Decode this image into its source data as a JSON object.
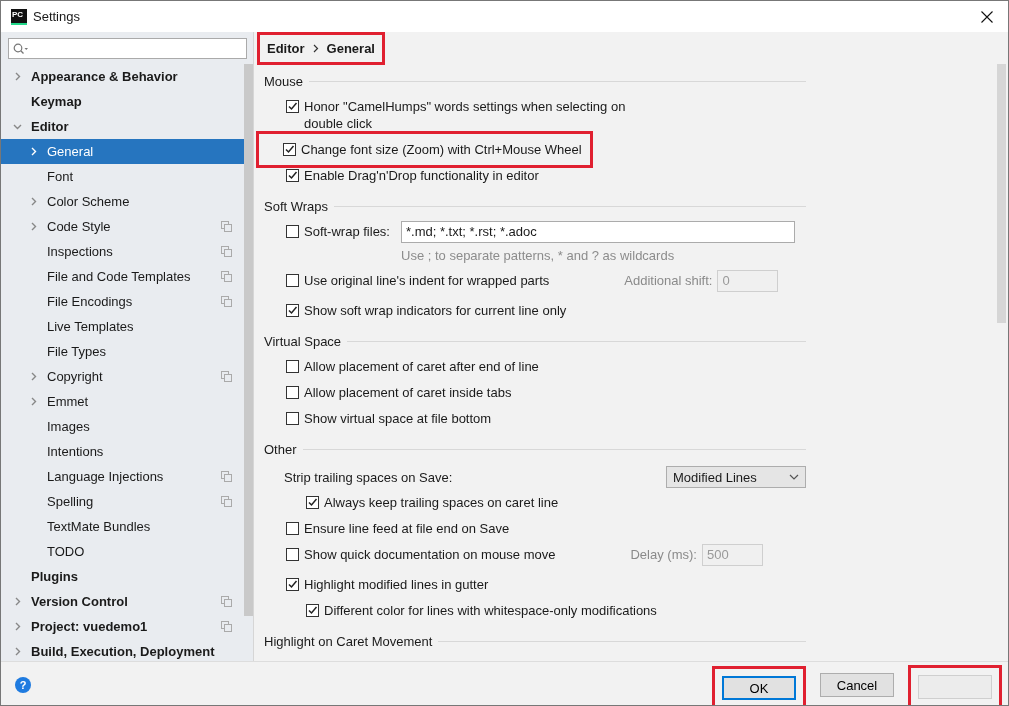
{
  "window": {
    "logo_text": "PC",
    "title": "Settings"
  },
  "sidebar": {
    "items": [
      {
        "label": "Appearance & Behavior",
        "bold": true,
        "expanded": false,
        "selected": false,
        "project_scope": false
      },
      {
        "label": "Keymap",
        "bold": true,
        "selected": false,
        "project_scope": false
      },
      {
        "label": "Editor",
        "bold": true,
        "expanded": true,
        "selected": false,
        "project_scope": false,
        "children": [
          {
            "label": "General",
            "bold": false,
            "expanded": false,
            "selected": true,
            "project_scope": false
          },
          {
            "label": "Font",
            "bold": false,
            "selected": false,
            "project_scope": false
          },
          {
            "label": "Color Scheme",
            "bold": false,
            "expanded": false,
            "selected": false,
            "project_scope": false
          },
          {
            "label": "Code Style",
            "bold": false,
            "expanded": false,
            "selected": false,
            "project_scope": true
          },
          {
            "label": "Inspections",
            "bold": false,
            "selected": false,
            "project_scope": true
          },
          {
            "label": "File and Code Templates",
            "bold": false,
            "selected": false,
            "project_scope": true
          },
          {
            "label": "File Encodings",
            "bold": false,
            "selected": false,
            "project_scope": true
          },
          {
            "label": "Live Templates",
            "bold": false,
            "selected": false,
            "project_scope": false
          },
          {
            "label": "File Types",
            "bold": false,
            "selected": false,
            "project_scope": false
          },
          {
            "label": "Copyright",
            "bold": false,
            "expanded": false,
            "selected": false,
            "project_scope": true
          },
          {
            "label": "Emmet",
            "bold": false,
            "expanded": false,
            "selected": false,
            "project_scope": false
          },
          {
            "label": "Images",
            "bold": false,
            "selected": false,
            "project_scope": false
          },
          {
            "label": "Intentions",
            "bold": false,
            "selected": false,
            "project_scope": false
          },
          {
            "label": "Language Injections",
            "bold": false,
            "selected": false,
            "project_scope": true
          },
          {
            "label": "Spelling",
            "bold": false,
            "selected": false,
            "project_scope": true
          },
          {
            "label": "TextMate Bundles",
            "bold": false,
            "selected": false,
            "project_scope": false
          },
          {
            "label": "TODO",
            "bold": false,
            "selected": false,
            "project_scope": false
          }
        ]
      },
      {
        "label": "Plugins",
        "bold": true,
        "selected": false,
        "project_scope": false
      },
      {
        "label": "Version Control",
        "bold": true,
        "expanded": false,
        "selected": false,
        "project_scope": true
      },
      {
        "label": "Project: vuedemo1",
        "bold": true,
        "expanded": false,
        "selected": false,
        "project_scope": true
      },
      {
        "label": "Build, Execution, Deployment",
        "bold": true,
        "expanded": false,
        "selected": false,
        "project_scope": false
      }
    ]
  },
  "breadcrumb": {
    "highlighted": true,
    "items": [
      "Editor",
      "General"
    ]
  },
  "sections": [
    {
      "title": "Mouse",
      "rows": [
        {
          "kind": "checkbox",
          "label": "Honor \"CamelHumps\" words settings when selecting on\ndouble click",
          "checked": true,
          "highlighted": false
        },
        {
          "kind": "checkbox",
          "label": "Change font size (Zoom) with Ctrl+Mouse Wheel",
          "checked": true,
          "highlighted": true
        },
        {
          "kind": "checkbox",
          "label": "Enable Drag'n'Drop functionality in editor",
          "checked": true,
          "highlighted": false
        }
      ]
    },
    {
      "title": "Soft Wraps",
      "rows": [
        {
          "kind": "checkbox",
          "label": "Soft-wrap files:",
          "checked": false,
          "highlighted": false,
          "field": {
            "value": "*.md; *.txt; *.rst; *.adoc",
            "disabled": false
          },
          "hint": "Use ; to separate patterns, * and ? as wildcards"
        },
        {
          "kind": "checkbox",
          "label": "Use original line's indent for wrapped parts",
          "checked": false,
          "highlighted": false,
          "field": {
            "label": "Additional shift:",
            "value": "0",
            "disabled": true
          }
        },
        {
          "kind": "checkbox",
          "label": "Show soft wrap indicators for current line only",
          "checked": true,
          "highlighted": false
        }
      ]
    },
    {
      "title": "Virtual Space",
      "rows": [
        {
          "kind": "checkbox",
          "label": "Allow placement of caret after end of line",
          "checked": false,
          "highlighted": false
        },
        {
          "kind": "checkbox",
          "label": "Allow placement of caret inside tabs",
          "checked": false,
          "highlighted": false
        },
        {
          "kind": "checkbox",
          "label": "Show virtual space at file bottom",
          "checked": false,
          "highlighted": false
        }
      ]
    },
    {
      "title": "Other",
      "rows": [
        {
          "kind": "dropdown",
          "label": "Strip trailing spaces on Save:",
          "value": "Modified Lines",
          "children": [
            {
              "kind": "checkbox",
              "label": "Always keep trailing spaces on caret line",
              "checked": true,
              "highlighted": false
            }
          ]
        },
        {
          "kind": "checkbox",
          "label": "Ensure line feed at file end on Save",
          "checked": false,
          "highlighted": false
        },
        {
          "kind": "checkbox",
          "label": "Show quick documentation on mouse move",
          "checked": false,
          "highlighted": false,
          "field": {
            "label": "Delay (ms):",
            "value": "500",
            "disabled": true
          }
        },
        {
          "kind": "checkbox",
          "label": "Highlight modified lines in gutter",
          "checked": true,
          "highlighted": false,
          "children": [
            {
              "kind": "checkbox",
              "label": "Different color for lines with whitespace-only modifications",
              "checked": true,
              "highlighted": false
            }
          ]
        }
      ]
    },
    {
      "title": "Highlight on Caret Movement"
    }
  ],
  "help": {
    "glyph": "?"
  },
  "buttons": [
    {
      "label": "OK",
      "kind": "default",
      "disabled": false,
      "highlighted": true
    },
    {
      "label": "Cancel",
      "kind": "normal",
      "disabled": false,
      "highlighted": false
    },
    {
      "kind": "normal",
      "disabled": true,
      "highlighted": true
    }
  ]
}
